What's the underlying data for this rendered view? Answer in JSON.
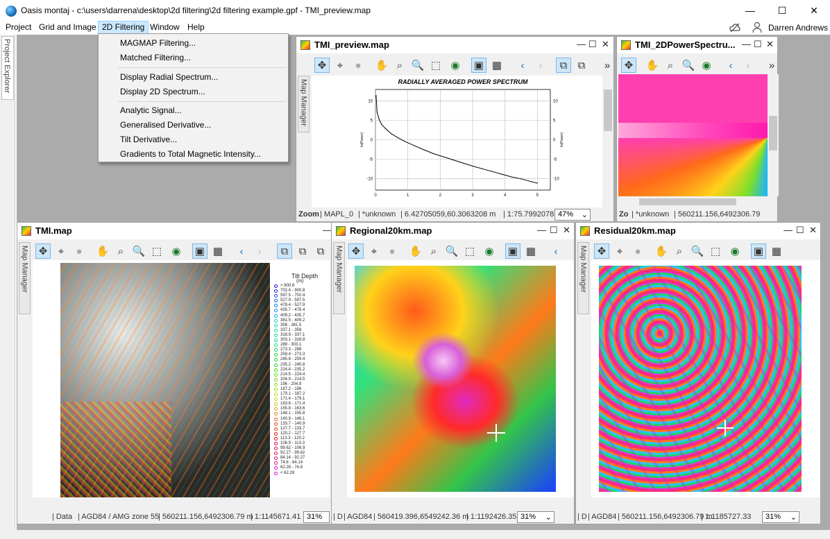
{
  "window": {
    "title": "Oasis montaj - c:\\users\\darrena\\desktop\\2d filtering\\2d filtering example.gpf - TMI_preview.map",
    "minimize": "—",
    "maximize": "☐",
    "close": "✕",
    "user": "Darren Andrews"
  },
  "menu": [
    "Project",
    "Grid and Image",
    "2D Filtering",
    "Window",
    "Help"
  ],
  "dropdown": {
    "group1": [
      "MAGMAP Filtering...",
      "Matched Filtering..."
    ],
    "group2": [
      "Display Radial Spectrum...",
      "Display 2D Spectrum..."
    ],
    "group3": [
      "Analytic Signal...",
      "Generalised Derivative...",
      "Tilt Derivative...",
      "Gradients to Total Magnetic Intensity..."
    ]
  },
  "project_explorer": "Project Explorer",
  "map_manager": "Map Manager",
  "windows": {
    "preview": {
      "title": "TMI_preview.map",
      "chart_title": "RADIALLY AVERAGED POWER SPECTRUM",
      "status": [
        "Zoom",
        "| MAPL_0",
        "| *unknown",
        "| 6.42705059,60.3063208 m",
        "| 1:75.7992078"
      ],
      "zoom": "47%"
    },
    "spectrum2d": {
      "title": "TMI_2DPowerSpectru...",
      "status": [
        "Zo",
        "| *unknown",
        "| 560211.156,6492306.79"
      ]
    },
    "tmi": {
      "title": "TMI.map",
      "legend_title": "Tilt Depth",
      "legend_unit": "(m)",
      "status": [
        "| Data",
        "| AGD84 / AMG zone 55",
        "| 560211.156,6492306.79 m",
        "| 1:1145671.41"
      ],
      "zoom": "31%"
    },
    "regional": {
      "title": "Regional20km.map",
      "status": [
        "| D",
        "| AGD84",
        "| 560419.396,6549242.36 m",
        "| 1:1192426.35"
      ],
      "zoom": "31%"
    },
    "residual": {
      "title": "Residual20km.map",
      "status": [
        "| D",
        "| AGD84",
        "| 560211.156,6492306.79 m",
        "| 1:1185727.33"
      ],
      "zoom": "31%"
    }
  },
  "chart_data": {
    "type": "line",
    "title": "RADIALLY AVERAGED POWER SPECTRUM",
    "xlabel": "",
    "ylabel": "ln(Power)",
    "x_ticks": [
      "0",
      "1",
      "2",
      "3",
      "4",
      "5"
    ],
    "y_ticks": [
      "10",
      "5",
      "0",
      "-5",
      "-10"
    ],
    "xlim": [
      0,
      5.4
    ],
    "ylim": [
      -13,
      13
    ],
    "grid": true,
    "series": [
      {
        "x": [
          0.02,
          0.05,
          0.1,
          0.15,
          0.2,
          0.3,
          0.4,
          0.5,
          0.7,
          0.9,
          1.2,
          1.5,
          1.8,
          2.1,
          2.4,
          2.7,
          3.0,
          3.3,
          3.6,
          3.9,
          4.2,
          4.5,
          4.8,
          5.0
        ],
        "y": [
          11.5,
          7.2,
          5.6,
          4.6,
          3.9,
          3.0,
          2.2,
          1.5,
          0.5,
          -0.4,
          -1.5,
          -2.6,
          -3.6,
          -4.4,
          -5.2,
          -6.0,
          -6.8,
          -7.5,
          -8.2,
          -8.9,
          -9.6,
          -10.1,
          -10.8,
          -11.2
        ]
      }
    ]
  },
  "tilt_legend": [
    "> 900.8",
    "702.4 - 900.8",
    "597.5 - 702.4",
    "527.9 - 597.5",
    "478.4 - 527.9",
    "435.7 - 478.4",
    "409.2 - 435.7",
    "381.5 - 409.2",
    "358 - 381.5",
    "337.1 - 358",
    "318.9 - 337.1",
    "303.1 - 318.9",
    "288 - 303.1",
    "273.3 - 288",
    "259.4 - 273.3",
    "245.8 - 259.4",
    "235.2 - 245.8",
    "224.4 - 235.2",
    "214.5 - 224.4",
    "204.9 - 214.5",
    "196 - 204.9",
    "187.2 - 196",
    "179.1 - 187.2",
    "171.4 - 179.1",
    "163.6 - 171.4",
    "155.8 - 163.6",
    "148.1 - 155.8",
    "140.9 - 148.1",
    "133.7 - 140.9",
    "127.7 - 133.7",
    "120.2 - 127.7",
    "113.3 - 120.2",
    "106.9 - 113.3",
    "99.62 - 106.9",
    "92.27 - 99.62",
    "84.14 - 92.27",
    "74.8 - 84.14",
    "62.28 - 74.8",
    "< 62.28"
  ],
  "colors": {
    "menu_highlight": "#cce8ff",
    "workspace": "#ababab",
    "tool_selected": "#cde6f7"
  }
}
